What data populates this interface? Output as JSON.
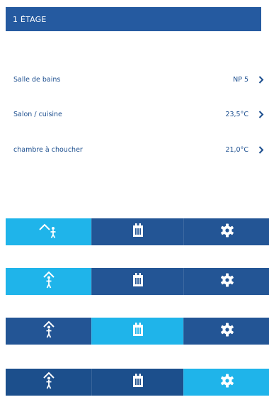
{
  "header": {
    "title": "1 ÉTAGE"
  },
  "rooms": [
    {
      "name": "Salle de bains",
      "value": "NP 5"
    },
    {
      "name": "Salon / cuisine",
      "value": "23,5°C"
    },
    {
      "name": "chambre à choucher",
      "value": "21,0°C"
    }
  ],
  "button_rows": [
    {
      "active": "away"
    },
    {
      "active": "presence"
    },
    {
      "active": "schedule"
    },
    {
      "active": "settings"
    }
  ],
  "colors": {
    "header_bg": "#255aa0",
    "active": "#1fb4ea",
    "inactive": "#235595",
    "text": "#1d4f8f"
  },
  "icons": [
    "away-person-icon",
    "person-home-icon",
    "calendar-icon",
    "gear-icon",
    "chevron-right-icon"
  ]
}
